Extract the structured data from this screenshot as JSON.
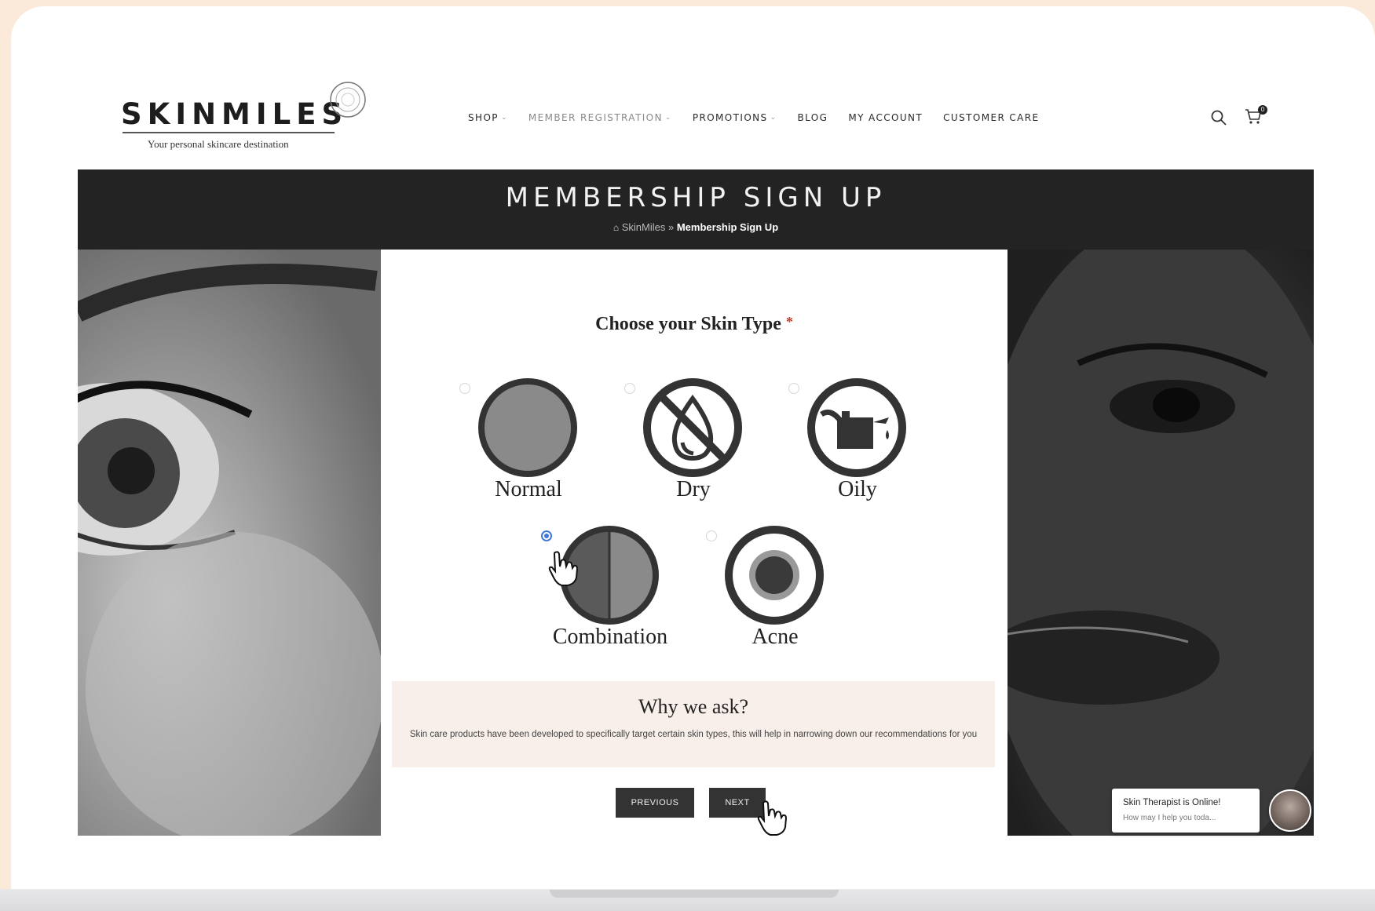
{
  "brand": {
    "name": "SKINMILES",
    "tagline": "Your personal skincare destination"
  },
  "nav": {
    "items": [
      {
        "label": "SHOP",
        "has_dropdown": true
      },
      {
        "label": "MEMBER REGISTRATION",
        "has_dropdown": true
      },
      {
        "label": "PROMOTIONS",
        "has_dropdown": true
      },
      {
        "label": "BLOG",
        "has_dropdown": false
      },
      {
        "label": "MY ACCOUNT",
        "has_dropdown": false
      },
      {
        "label": "CUSTOMER CARE",
        "has_dropdown": false
      }
    ],
    "cart_count": "0"
  },
  "banner": {
    "title": "MEMBERSHIP SIGN UP",
    "breadcrumb_home": "SkinMiles",
    "breadcrumb_separator": "»",
    "breadcrumb_current": "Membership Sign Up"
  },
  "form": {
    "question": "Choose your Skin Type",
    "required_mark": "*",
    "options": [
      {
        "label": "Normal",
        "selected": false,
        "icon": "normal-skin-icon"
      },
      {
        "label": "Dry",
        "selected": false,
        "icon": "dry-skin-icon"
      },
      {
        "label": "Oily",
        "selected": false,
        "icon": "oily-skin-icon"
      },
      {
        "label": "Combination",
        "selected": true,
        "icon": "combination-skin-icon"
      },
      {
        "label": "Acne",
        "selected": false,
        "icon": "acne-skin-icon"
      }
    ],
    "info_title": "Why we ask?",
    "info_text": "Skin care products have been developed to specifically target certain skin types, this will help in narrowing down our recommendations for you",
    "prev_label": "PREVIOUS",
    "next_label": "NEXT"
  },
  "chat": {
    "title": "Skin Therapist is Online!",
    "subtitle": "How may I help you toda..."
  },
  "colors": {
    "banner_bg": "#232323",
    "info_bg": "#f9efea",
    "radio_selected": "#3f78d6",
    "button_bg": "#333333"
  }
}
